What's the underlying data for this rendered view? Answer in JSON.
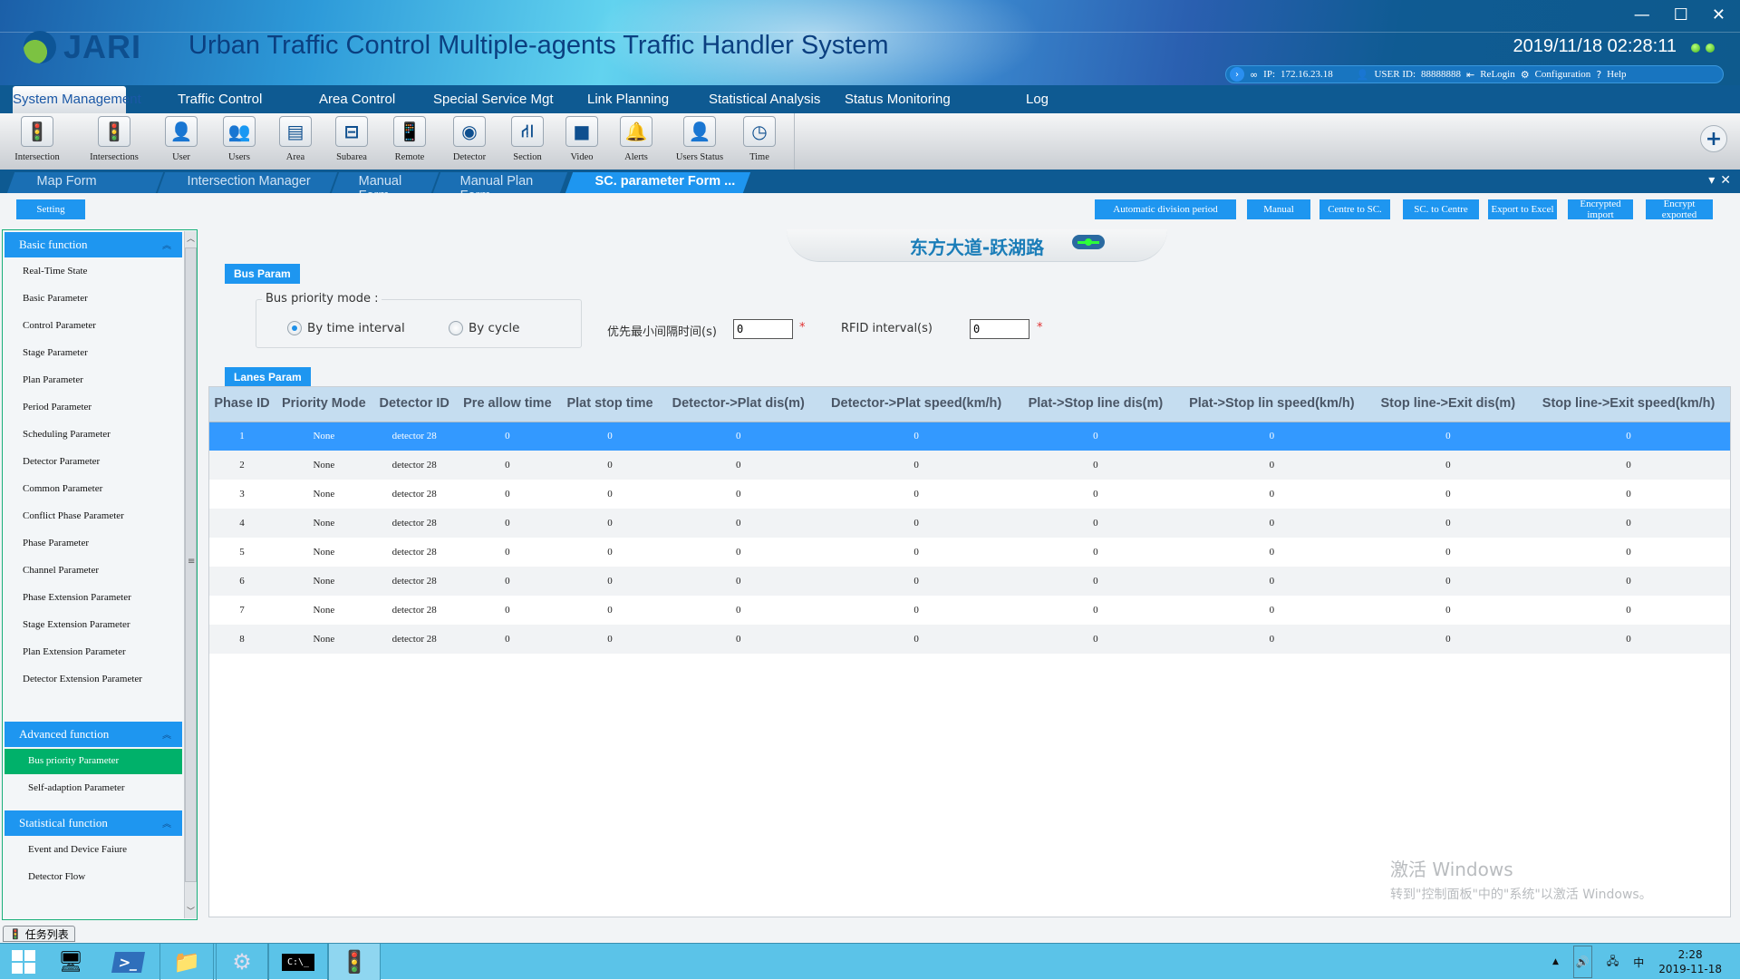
{
  "header": {
    "logo_text": "JARI",
    "app_title": "Urban Traffic Control Multiple-agents Traffic Handler System",
    "datetime": "2019/11/18 02:28:11",
    "ip_label": "IP:",
    "ip_value": "172.16.23.18",
    "user_label": "USER ID:",
    "user_value": "88888888",
    "relogin": "ReLogin",
    "configuration": "Configuration",
    "help": "Help",
    "window_controls": {
      "minimize": "—",
      "maximize": "☐",
      "close": "✕"
    }
  },
  "menu": [
    {
      "label": "System Management",
      "active": true
    },
    {
      "label": "Traffic Control"
    },
    {
      "label": "Area Control"
    },
    {
      "label": "Special Service Mgt"
    },
    {
      "label": "Link Planning"
    },
    {
      "label": "Statistical Analysis"
    },
    {
      "label": "Status Monitoring"
    },
    {
      "label": "Log"
    }
  ],
  "toolbar": [
    {
      "label": "Intersection",
      "icon": "traffic-light-icon",
      "glyph": "🚦"
    },
    {
      "label": "Intersections",
      "icon": "traffic-lights-icon",
      "glyph": "🚦"
    },
    {
      "label": "User",
      "icon": "user-icon",
      "glyph": "👤"
    },
    {
      "label": "Users",
      "icon": "users-icon",
      "glyph": "👥"
    },
    {
      "label": "Area",
      "icon": "server-icon",
      "glyph": "▤"
    },
    {
      "label": "Subarea",
      "icon": "network-icon",
      "glyph": "⊟"
    },
    {
      "label": "Remote",
      "icon": "remote-icon",
      "glyph": "📱"
    },
    {
      "label": "Detector",
      "icon": "detector-icon",
      "glyph": "◉"
    },
    {
      "label": "Section",
      "icon": "road-section-icon",
      "glyph": "⛙"
    },
    {
      "label": "Video",
      "icon": "video-icon",
      "glyph": "■"
    },
    {
      "label": "Alerts",
      "icon": "alarm-icon",
      "glyph": "🔔"
    },
    {
      "label": "Users Status",
      "icon": "user-status-icon",
      "glyph": "👤"
    },
    {
      "label": "Time",
      "icon": "clock-icon",
      "glyph": "◷"
    }
  ],
  "tabs": [
    {
      "label": "Map  Form"
    },
    {
      "label": "Intersection Manager"
    },
    {
      "label": "Manual Form"
    },
    {
      "label": "Manual Plan  Form"
    },
    {
      "label": "SC. parameter Form   ...",
      "active": true
    }
  ],
  "actions": {
    "setting": "Setting",
    "auto_division": "Automatic division period",
    "manual": "Manual",
    "centre_to_sc": "Centre to SC.",
    "sc_to_centre": "SC. to Centre",
    "export_excel": "Export to Excel",
    "encrypted_import": "Encrypted import",
    "encrypt_exported": "Encrypt exported"
  },
  "sidebar": {
    "basic": {
      "title": "Basic function",
      "items": [
        "Real-Time State",
        "Basic Parameter",
        "Control Parameter",
        "Stage Parameter",
        "Plan Parameter",
        "Period Parameter",
        "Scheduling Parameter",
        "Detector Parameter",
        "Common Parameter",
        "Conflict Phase Parameter",
        "Phase Parameter",
        "Channel Parameter",
        "Phase Extension Parameter",
        "Stage Extension Parameter",
        "Plan Extension Parameter",
        "Detector Extension Parameter"
      ]
    },
    "advanced": {
      "title": "Advanced function",
      "items": [
        "Bus priority Parameter",
        "Self-adaption Parameter"
      ],
      "active_index": 0
    },
    "statistical": {
      "title": "Statistical function",
      "items": [
        "Event and Device Faiure",
        "Detector Flow"
      ]
    }
  },
  "main": {
    "intersection_name": "东方大道-跃湖路",
    "bus_param_label": "Bus Param",
    "bus_priority_mode_label": "Bus priority mode :",
    "radio_time_interval": "By time interval",
    "radio_cycle": "By cycle",
    "selected_mode": "By time interval",
    "min_interval_label": "优先最小间隔时间(s)",
    "min_interval_value": "0",
    "rfid_label": "RFID interval(s)",
    "rfid_value": "0",
    "required_mark": "*",
    "lanes_param_label": "Lanes Param"
  },
  "table": {
    "columns": [
      "Phase ID",
      "Priority Mode",
      "Detector ID",
      "Pre allow time",
      "Plat stop time",
      "Detector->Plat dis(m)",
      "Detector->Plat speed(km/h)",
      "Plat->Stop line dis(m)",
      "Plat->Stop lin speed(km/h)",
      "Stop line->Exit dis(m)",
      "Stop line->Exit speed(km/h)"
    ],
    "selected_row": 0,
    "rows": [
      [
        "1",
        "None",
        "detector 28",
        "0",
        "0",
        "0",
        "0",
        "0",
        "0",
        "0",
        "0"
      ],
      [
        "2",
        "None",
        "detector 28",
        "0",
        "0",
        "0",
        "0",
        "0",
        "0",
        "0",
        "0"
      ],
      [
        "3",
        "None",
        "detector 28",
        "0",
        "0",
        "0",
        "0",
        "0",
        "0",
        "0",
        "0"
      ],
      [
        "4",
        "None",
        "detector 28",
        "0",
        "0",
        "0",
        "0",
        "0",
        "0",
        "0",
        "0"
      ],
      [
        "5",
        "None",
        "detector 28",
        "0",
        "0",
        "0",
        "0",
        "0",
        "0",
        "0",
        "0"
      ],
      [
        "6",
        "None",
        "detector 28",
        "0",
        "0",
        "0",
        "0",
        "0",
        "0",
        "0",
        "0"
      ],
      [
        "7",
        "None",
        "detector 28",
        "0",
        "0",
        "0",
        "0",
        "0",
        "0",
        "0",
        "0"
      ],
      [
        "8",
        "None",
        "detector 28",
        "0",
        "0",
        "0",
        "0",
        "0",
        "0",
        "0",
        "0"
      ]
    ]
  },
  "watermark": {
    "line1": "激活 Windows",
    "line2": "转到\"控制面板\"中的\"系统\"以激活 Windows。"
  },
  "task_list_label": "任务列表",
  "taskbar": {
    "ime": "中",
    "time": "2:28",
    "date": "2019-11-18"
  },
  "colors": {
    "accent": "#1e96f0",
    "active_green": "#00b16a",
    "selected_row": "#3399ff",
    "menubar": "#0e5a92"
  }
}
